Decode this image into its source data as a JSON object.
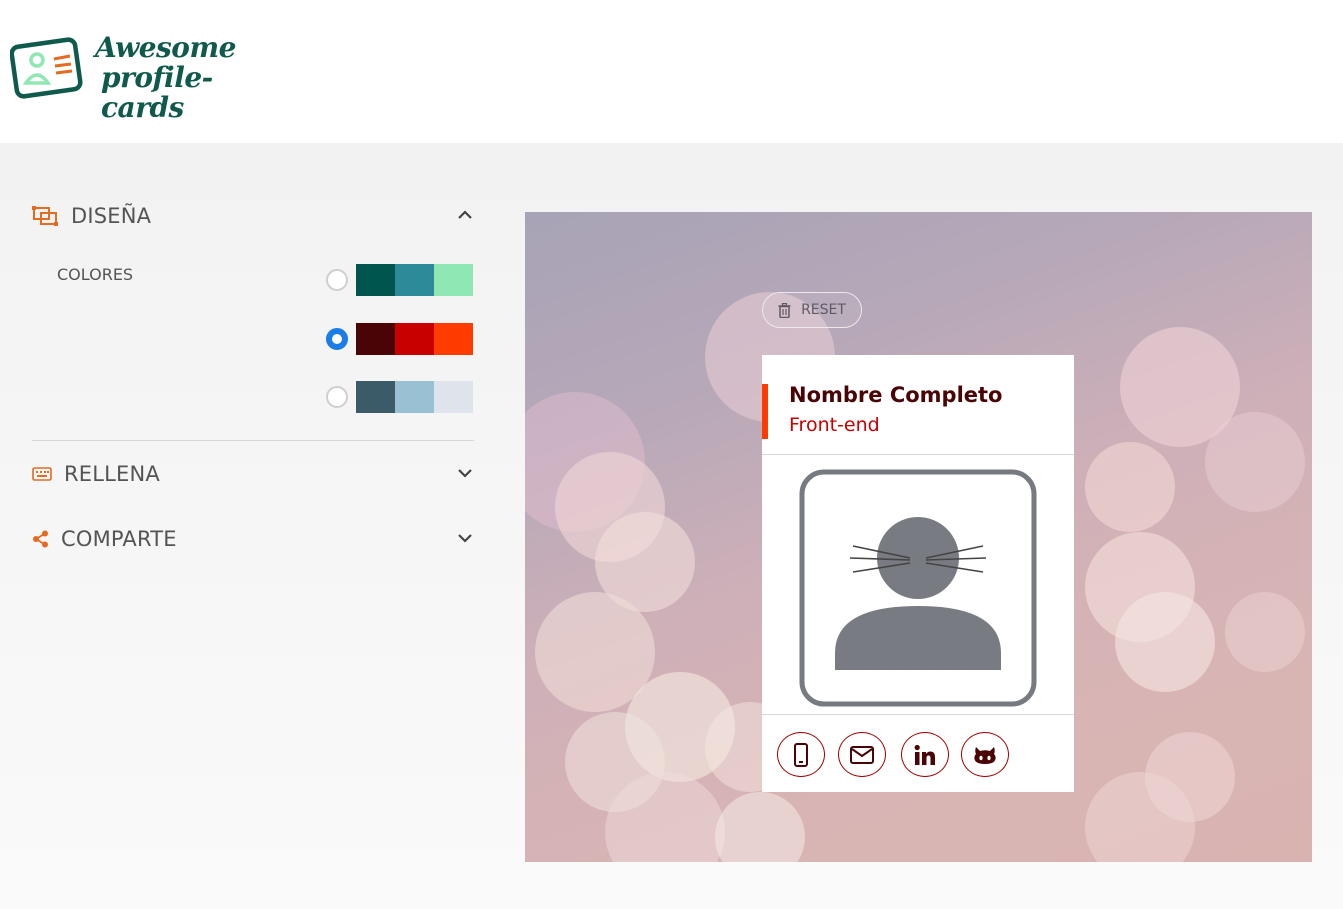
{
  "app": {
    "logo_line1": "Awesome",
    "logo_line2": "profile-cards"
  },
  "panel": {
    "design": {
      "title": "DISEÑA",
      "icon": "layout-design-icon",
      "expanded": true
    },
    "colors_label": "COLORES",
    "palettes": [
      {
        "id": "palette-1",
        "selected": false,
        "colors": [
          "#00564f",
          "#2d8a97",
          "#8fe8b4"
        ]
      },
      {
        "id": "palette-2",
        "selected": true,
        "colors": [
          "#4a0406",
          "#c80000",
          "#ff3b00"
        ]
      },
      {
        "id": "palette-3",
        "selected": false,
        "colors": [
          "#3c5b69",
          "#9ac0d3",
          "#dfe4ec"
        ]
      }
    ],
    "fill": {
      "title": "RELLENA",
      "icon": "keyboard-icon",
      "expanded": false
    },
    "share": {
      "title": "COMPARTE",
      "icon": "share-icon",
      "expanded": false
    }
  },
  "preview": {
    "reset_label": "RESET",
    "card": {
      "name": "Nombre Completo",
      "job": "Front-end",
      "accent_color": "#ff3b00",
      "name_color": "#4a0406",
      "job_color": "#c80000",
      "social": [
        "phone-icon",
        "email-icon",
        "linkedin-icon",
        "github-icon"
      ]
    }
  },
  "colors": {
    "brand": "#0f5a4c",
    "accent_orange": "#e46b1f",
    "radio_selected": "#1a7de8"
  }
}
